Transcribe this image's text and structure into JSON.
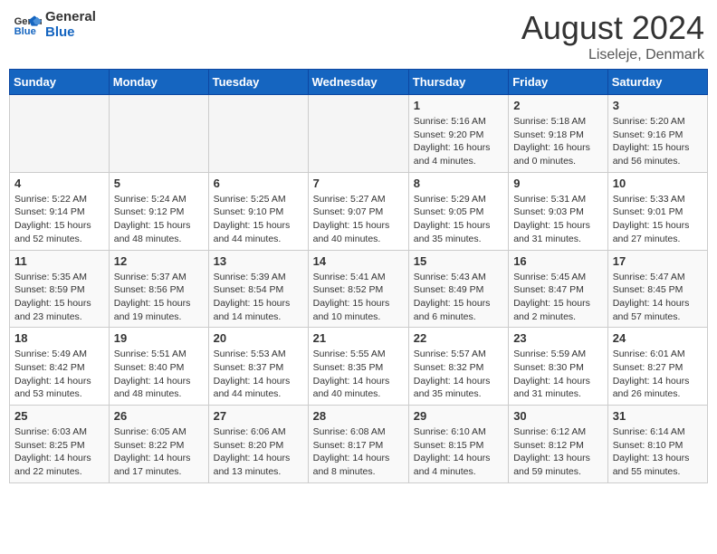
{
  "header": {
    "logo": {
      "general": "General",
      "blue": "Blue"
    },
    "title": "August 2024",
    "subtitle": "Liseleje, Denmark"
  },
  "calendar": {
    "days_of_week": [
      "Sunday",
      "Monday",
      "Tuesday",
      "Wednesday",
      "Thursday",
      "Friday",
      "Saturday"
    ],
    "weeks": [
      {
        "days": [
          {
            "number": "",
            "info": ""
          },
          {
            "number": "",
            "info": ""
          },
          {
            "number": "",
            "info": ""
          },
          {
            "number": "",
            "info": ""
          },
          {
            "number": "1",
            "info": "Sunrise: 5:16 AM\nSunset: 9:20 PM\nDaylight: 16 hours\nand 4 minutes."
          },
          {
            "number": "2",
            "info": "Sunrise: 5:18 AM\nSunset: 9:18 PM\nDaylight: 16 hours\nand 0 minutes."
          },
          {
            "number": "3",
            "info": "Sunrise: 5:20 AM\nSunset: 9:16 PM\nDaylight: 15 hours\nand 56 minutes."
          }
        ]
      },
      {
        "days": [
          {
            "number": "4",
            "info": "Sunrise: 5:22 AM\nSunset: 9:14 PM\nDaylight: 15 hours\nand 52 minutes."
          },
          {
            "number": "5",
            "info": "Sunrise: 5:24 AM\nSunset: 9:12 PM\nDaylight: 15 hours\nand 48 minutes."
          },
          {
            "number": "6",
            "info": "Sunrise: 5:25 AM\nSunset: 9:10 PM\nDaylight: 15 hours\nand 44 minutes."
          },
          {
            "number": "7",
            "info": "Sunrise: 5:27 AM\nSunset: 9:07 PM\nDaylight: 15 hours\nand 40 minutes."
          },
          {
            "number": "8",
            "info": "Sunrise: 5:29 AM\nSunset: 9:05 PM\nDaylight: 15 hours\nand 35 minutes."
          },
          {
            "number": "9",
            "info": "Sunrise: 5:31 AM\nSunset: 9:03 PM\nDaylight: 15 hours\nand 31 minutes."
          },
          {
            "number": "10",
            "info": "Sunrise: 5:33 AM\nSunset: 9:01 PM\nDaylight: 15 hours\nand 27 minutes."
          }
        ]
      },
      {
        "days": [
          {
            "number": "11",
            "info": "Sunrise: 5:35 AM\nSunset: 8:59 PM\nDaylight: 15 hours\nand 23 minutes."
          },
          {
            "number": "12",
            "info": "Sunrise: 5:37 AM\nSunset: 8:56 PM\nDaylight: 15 hours\nand 19 minutes."
          },
          {
            "number": "13",
            "info": "Sunrise: 5:39 AM\nSunset: 8:54 PM\nDaylight: 15 hours\nand 14 minutes."
          },
          {
            "number": "14",
            "info": "Sunrise: 5:41 AM\nSunset: 8:52 PM\nDaylight: 15 hours\nand 10 minutes."
          },
          {
            "number": "15",
            "info": "Sunrise: 5:43 AM\nSunset: 8:49 PM\nDaylight: 15 hours\nand 6 minutes."
          },
          {
            "number": "16",
            "info": "Sunrise: 5:45 AM\nSunset: 8:47 PM\nDaylight: 15 hours\nand 2 minutes."
          },
          {
            "number": "17",
            "info": "Sunrise: 5:47 AM\nSunset: 8:45 PM\nDaylight: 14 hours\nand 57 minutes."
          }
        ]
      },
      {
        "days": [
          {
            "number": "18",
            "info": "Sunrise: 5:49 AM\nSunset: 8:42 PM\nDaylight: 14 hours\nand 53 minutes."
          },
          {
            "number": "19",
            "info": "Sunrise: 5:51 AM\nSunset: 8:40 PM\nDaylight: 14 hours\nand 48 minutes."
          },
          {
            "number": "20",
            "info": "Sunrise: 5:53 AM\nSunset: 8:37 PM\nDaylight: 14 hours\nand 44 minutes."
          },
          {
            "number": "21",
            "info": "Sunrise: 5:55 AM\nSunset: 8:35 PM\nDaylight: 14 hours\nand 40 minutes."
          },
          {
            "number": "22",
            "info": "Sunrise: 5:57 AM\nSunset: 8:32 PM\nDaylight: 14 hours\nand 35 minutes."
          },
          {
            "number": "23",
            "info": "Sunrise: 5:59 AM\nSunset: 8:30 PM\nDaylight: 14 hours\nand 31 minutes."
          },
          {
            "number": "24",
            "info": "Sunrise: 6:01 AM\nSunset: 8:27 PM\nDaylight: 14 hours\nand 26 minutes."
          }
        ]
      },
      {
        "days": [
          {
            "number": "25",
            "info": "Sunrise: 6:03 AM\nSunset: 8:25 PM\nDaylight: 14 hours\nand 22 minutes."
          },
          {
            "number": "26",
            "info": "Sunrise: 6:05 AM\nSunset: 8:22 PM\nDaylight: 14 hours\nand 17 minutes."
          },
          {
            "number": "27",
            "info": "Sunrise: 6:06 AM\nSunset: 8:20 PM\nDaylight: 14 hours\nand 13 minutes."
          },
          {
            "number": "28",
            "info": "Sunrise: 6:08 AM\nSunset: 8:17 PM\nDaylight: 14 hours\nand 8 minutes."
          },
          {
            "number": "29",
            "info": "Sunrise: 6:10 AM\nSunset: 8:15 PM\nDaylight: 14 hours\nand 4 minutes."
          },
          {
            "number": "30",
            "info": "Sunrise: 6:12 AM\nSunset: 8:12 PM\nDaylight: 13 hours\nand 59 minutes."
          },
          {
            "number": "31",
            "info": "Sunrise: 6:14 AM\nSunset: 8:10 PM\nDaylight: 13 hours\nand 55 minutes."
          }
        ]
      }
    ]
  }
}
